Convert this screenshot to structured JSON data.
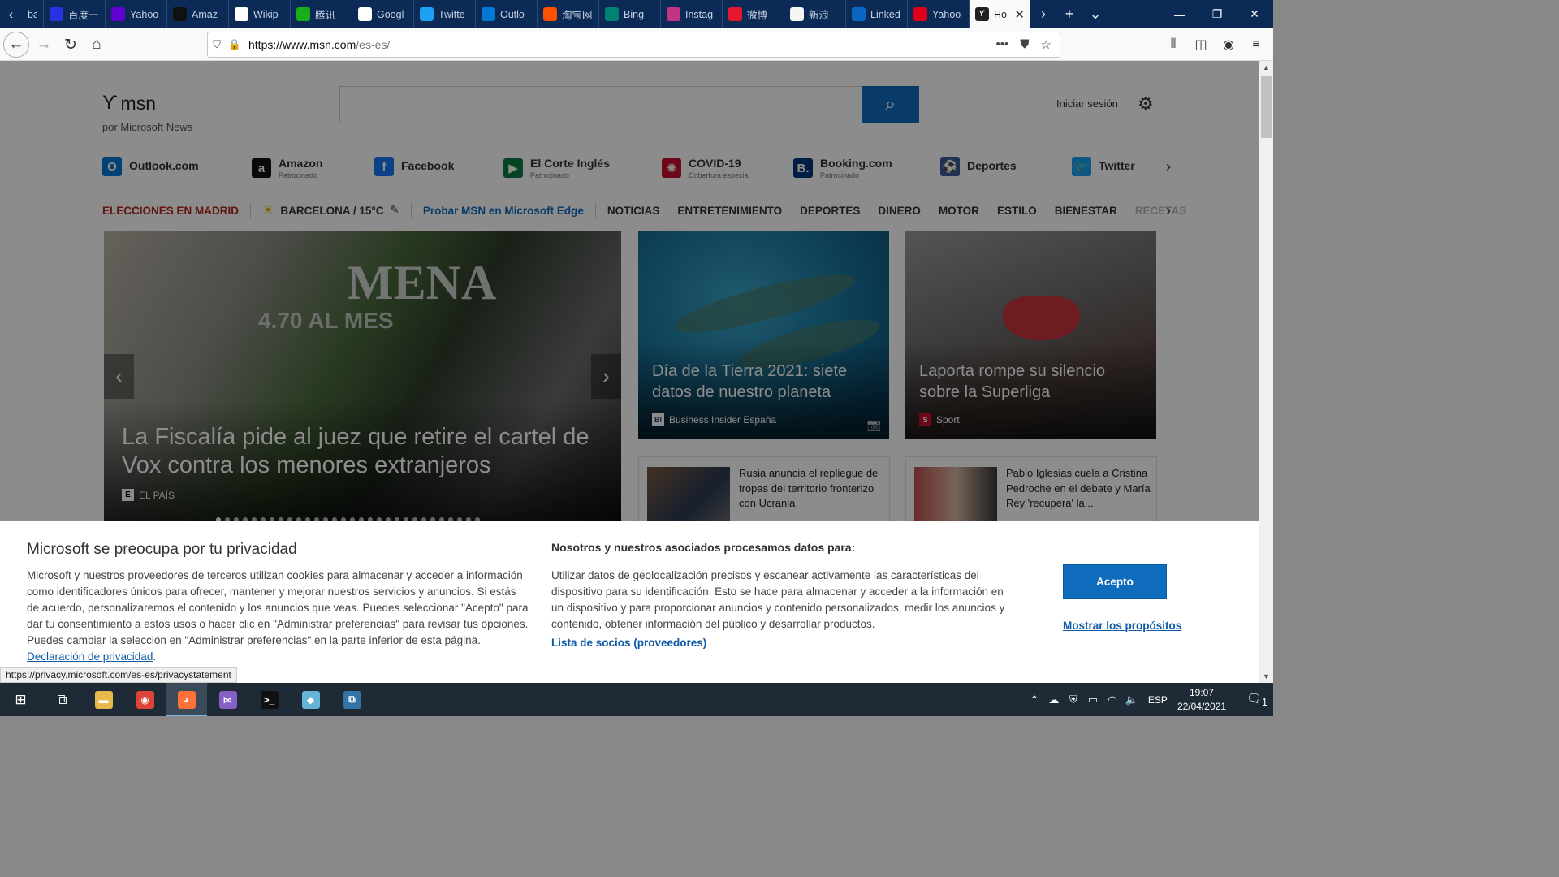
{
  "browser": {
    "tabs": [
      {
        "label": "ba",
        "favicon": "baidu",
        "color": "#2f5aa8"
      },
      {
        "label": "百度一",
        "favicon": "baidu-paw-icon",
        "color": "#2932e1"
      },
      {
        "label": "Yahoo",
        "favicon": "yahoo-icon",
        "color": "#6001d2"
      },
      {
        "label": "Amaz",
        "favicon": "amazon-icon",
        "color": "#111111"
      },
      {
        "label": "Wikip",
        "favicon": "wikipedia-icon",
        "color": "#ffffff"
      },
      {
        "label": "腾讯",
        "favicon": "tencent-icon",
        "color": "#1aad19"
      },
      {
        "label": "Googl",
        "favicon": "google-icon",
        "color": "#ffffff"
      },
      {
        "label": "Twitte",
        "favicon": "twitter-icon",
        "color": "#1da1f2"
      },
      {
        "label": "Outlo",
        "favicon": "outlook-icon",
        "color": "#0078d4"
      },
      {
        "label": "淘宝网",
        "favicon": "taobao-icon",
        "color": "#ff5000"
      },
      {
        "label": "Bing",
        "favicon": "bing-icon",
        "color": "#008373"
      },
      {
        "label": "Instag",
        "favicon": "instagram-icon",
        "color": "#c13584"
      },
      {
        "label": "微博",
        "favicon": "weibo-icon",
        "color": "#e6162d"
      },
      {
        "label": "新浪",
        "favicon": "sina-icon",
        "color": "#f5f5f5"
      },
      {
        "label": "Linked",
        "favicon": "linkedin-icon",
        "color": "#0a66c2"
      },
      {
        "label": "Yahoo",
        "favicon": "yahoo-red-icon",
        "color": "#e0001b"
      }
    ],
    "active_tab": {
      "label": "Ho",
      "favicon": "msn-icon"
    },
    "url": {
      "scheme_host": "https://www.msn.com",
      "path": "/es-es/"
    }
  },
  "msn": {
    "logo": "msn",
    "tagline": "por Microsoft News",
    "signin": "Iniciar sesión",
    "quicklinks": [
      {
        "name": "Outlook.com",
        "sub": "",
        "icon": "outlook-icon",
        "color": "#0078d4",
        "glyph": "O"
      },
      {
        "name": "Amazon",
        "sub": "Patrocinado",
        "icon": "amazon-icon",
        "color": "#111111",
        "glyph": "a"
      },
      {
        "name": "Facebook",
        "sub": "",
        "icon": "facebook-icon",
        "color": "#1877f2",
        "glyph": "f"
      },
      {
        "name": "El Corte Inglés",
        "sub": "Patrocinado",
        "icon": "el-corte-ingles-icon",
        "color": "#0b7a3e",
        "glyph": "▶"
      },
      {
        "name": "COVID-19",
        "sub": "Cobertura especial",
        "icon": "covid-icon",
        "color": "#c8102e",
        "glyph": "✺"
      },
      {
        "name": "Booking.com",
        "sub": "Patrocinado",
        "icon": "booking-icon",
        "color": "#003580",
        "glyph": "B."
      },
      {
        "name": "Deportes",
        "sub": "",
        "icon": "sports-icon",
        "color": "#3a5a9a",
        "glyph": "⚽"
      },
      {
        "name": "Twitter",
        "sub": "",
        "icon": "twitter-icon",
        "color": "#1da1f2",
        "glyph": "🐦"
      }
    ],
    "category_bar": {
      "elections": "ELECCIONES EN MADRID",
      "weather": "BARCELONA / 15°C",
      "edge_promo": "Probar MSN en Microsoft Edge",
      "categories": [
        "NOTICIAS",
        "ENTRETENIMIENTO",
        "DEPORTES",
        "DINERO",
        "MOTOR",
        "ESTILO",
        "BIENESTAR",
        "RECETAS"
      ]
    },
    "hero": {
      "title": "La Fiscalía pide al juez que retire el cartel de Vox contra los menores extranjeros",
      "source": "EL PAÍS",
      "poster_text": "MENA",
      "poster_text2": "4.70 AL MES",
      "slide_count": 30,
      "active_slide": 1
    },
    "cards": [
      {
        "title": "Día de la Tierra 2021: siete datos de nuestro planeta",
        "source": "Business Insider España",
        "source_badge": "BI"
      },
      {
        "title": "Laporta rompe su silencio sobre la Superliga",
        "source": "Sport",
        "source_badge": "S"
      }
    ],
    "mini_cards": [
      {
        "title": "Rusia anuncia el repliegue de tropas del territorio fronterizo con Ucrania"
      },
      {
        "title": "Pablo Iglesias cuela a Cristina Pedroche en el debate y María Rey 'recupera' la..."
      }
    ]
  },
  "privacy": {
    "title": "Microsoft se preocupa por tu privacidad",
    "body": "Microsoft y nuestros proveedores de terceros utilizan cookies para almacenar y acceder a información como identificadores únicos para ofrecer, mantener y mejorar nuestros servicios y anuncios. Si estás de acuerdo, personalizaremos el contenido y los anuncios que veas. Puedes seleccionar \"Acepto\" para dar tu consentimiento a estos usos o hacer clic en \"Administrar preferencias\" para revisar tus opciones. Puedes cambiar la selección en \"Administrar preferencias\" en la parte inferior de esta página.",
    "privacy_link": "Declaración de privacidad",
    "title2": "Nosotros y nuestros asociados procesamos datos para:",
    "body2": "Utilizar datos de geolocalización precisos y escanear activamente las características del dispositivo para su identificación. Esto se hace para almacenar y acceder a la información en un dispositivo y para proporcionar anuncios y contenido personalizados, medir los anuncios y contenido, obtener información del público y desarrollar productos.",
    "partners_link": "Lista de socios (proveedores)",
    "accept": "Acepto",
    "purposes": "Mostrar los propósitos",
    "status_url": "https://privacy.microsoft.com/es-es/privacystatement"
  },
  "taskbar": {
    "apps": [
      {
        "name": "file-explorer",
        "color": "#e8b84a",
        "glyph": "▬"
      },
      {
        "name": "chrome",
        "color": "#db4437",
        "glyph": "◉"
      },
      {
        "name": "firefox",
        "color": "#ff7139",
        "glyph": "◕",
        "active": true
      },
      {
        "name": "visual-studio",
        "color": "#865fc5",
        "glyph": "⋈"
      },
      {
        "name": "terminal",
        "color": "#111111",
        "glyph": ">_"
      },
      {
        "name": "app-blue",
        "color": "#66b3d6",
        "glyph": "◆"
      },
      {
        "name": "python-app",
        "color": "#3572a5",
        "glyph": "⧉"
      }
    ],
    "lang": "ESP",
    "time": "19:07",
    "date": "22/04/2021",
    "notifications": "1"
  }
}
